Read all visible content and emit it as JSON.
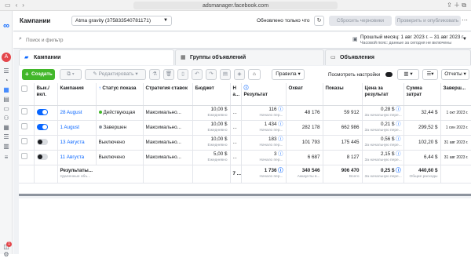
{
  "browser": {
    "url": "adsmanager.facebook.com"
  },
  "header": {
    "title": "Кампании",
    "account": "Atma gravity (375833540781171)",
    "updated": "Обновлено только что",
    "discard_btn": "Сбросить черновики",
    "publish_btn": "Проверить и опубликовать"
  },
  "search": {
    "placeholder": "Поиск и фильтр"
  },
  "daterange": {
    "label": "Прошлый месяц: 1 авг 2023 г. – 31 авг 2023 г.",
    "timezone_note": "Часовой пояс: данные за сегодня не включены"
  },
  "tabs": [
    {
      "label": "Кампании"
    },
    {
      "label": "Группы объявлений"
    },
    {
      "label": "Объявления"
    }
  ],
  "toolbar": {
    "create": "Создать",
    "edit": "Редактировать",
    "rules": "Правила",
    "view_settings": "Посмотреть настройки",
    "reports": "Отчеты"
  },
  "table": {
    "headers": {
      "onoff": "Вык./ вкл.",
      "campaign": "Кампания",
      "status": "Статус показа",
      "strategy": "Стратегия ставок",
      "budget": "Бюджет",
      "attribution": "Н а...",
      "results": "Результат",
      "reach": "Охват",
      "impressions": "Показы",
      "cost_per_result": "Цена за результат",
      "amount_spent": "Сумма затрат",
      "ends": "Заверш..."
    },
    "rows": [
      {
        "on": true,
        "name": "28 August",
        "status": "Действующая",
        "status_color": "green",
        "strategy": "Максимально...",
        "budget": "10,00 $",
        "budget_sub": "Ежедневно",
        "attr": "...",
        "result": "116",
        "result_sub": "Начало пер...",
        "reach": "48 176",
        "impressions": "59 912",
        "cpr": "0,28 $",
        "cpr_sub": "За начальную пере...",
        "spent": "32,44 $",
        "ends": "1 окт 2023 г."
      },
      {
        "on": true,
        "name": "1 August",
        "status": "Завершен",
        "status_color": "gray",
        "strategy": "Максимально...",
        "budget": "10,00 $",
        "budget_sub": "Ежедневно",
        "attr": "...",
        "result": "1 434",
        "result_sub": "Начало пер...",
        "reach": "282 178",
        "impressions": "662 986",
        "cpr": "0,21 $",
        "cpr_sub": "За начальную пере...",
        "spent": "299,52 $",
        "ends": "1 сен 2023 г."
      },
      {
        "on": false,
        "name": "13 Августа",
        "status": "Выключено",
        "status_color": "none",
        "strategy": "Максимально...",
        "budget": "10,00 $",
        "budget_sub": "Ежедневно",
        "attr": "...",
        "result": "183",
        "result_sub": "Начало пер...",
        "reach": "101 793",
        "impressions": "175 445",
        "cpr": "0,56 $",
        "cpr_sub": "За начальную пере...",
        "spent": "102,20 $",
        "ends": "31 авг 2023 г."
      },
      {
        "on": false,
        "name": "11 Августа",
        "status": "Выключено",
        "status_color": "none",
        "strategy": "Максимально...",
        "budget": "5,00 $",
        "budget_sub": "Ежедневно",
        "attr": "...",
        "result": "3",
        "result_sub": "Начало пер...",
        "reach": "6 687",
        "impressions": "8 127",
        "cpr": "2,15 $",
        "cpr_sub": "За начальную пере...",
        "spent": "6,44 $",
        "ends": "31 авг 2023 г."
      }
    ],
    "totals": {
      "label": "Результаты...",
      "label_sub": "Удаленные объ...",
      "attr": "7 ...",
      "result": "1 736",
      "result_sub": "Начало пер...",
      "reach": "340 546",
      "reach_sub": "Аккаунты в...",
      "impressions": "906 470",
      "impressions_sub": "Всего",
      "cpr": "0,25 $",
      "cpr_sub": "За начальную пере...",
      "spent": "440,60 $",
      "spent_sub": "Общие расходы"
    }
  },
  "notif_count": "1"
}
